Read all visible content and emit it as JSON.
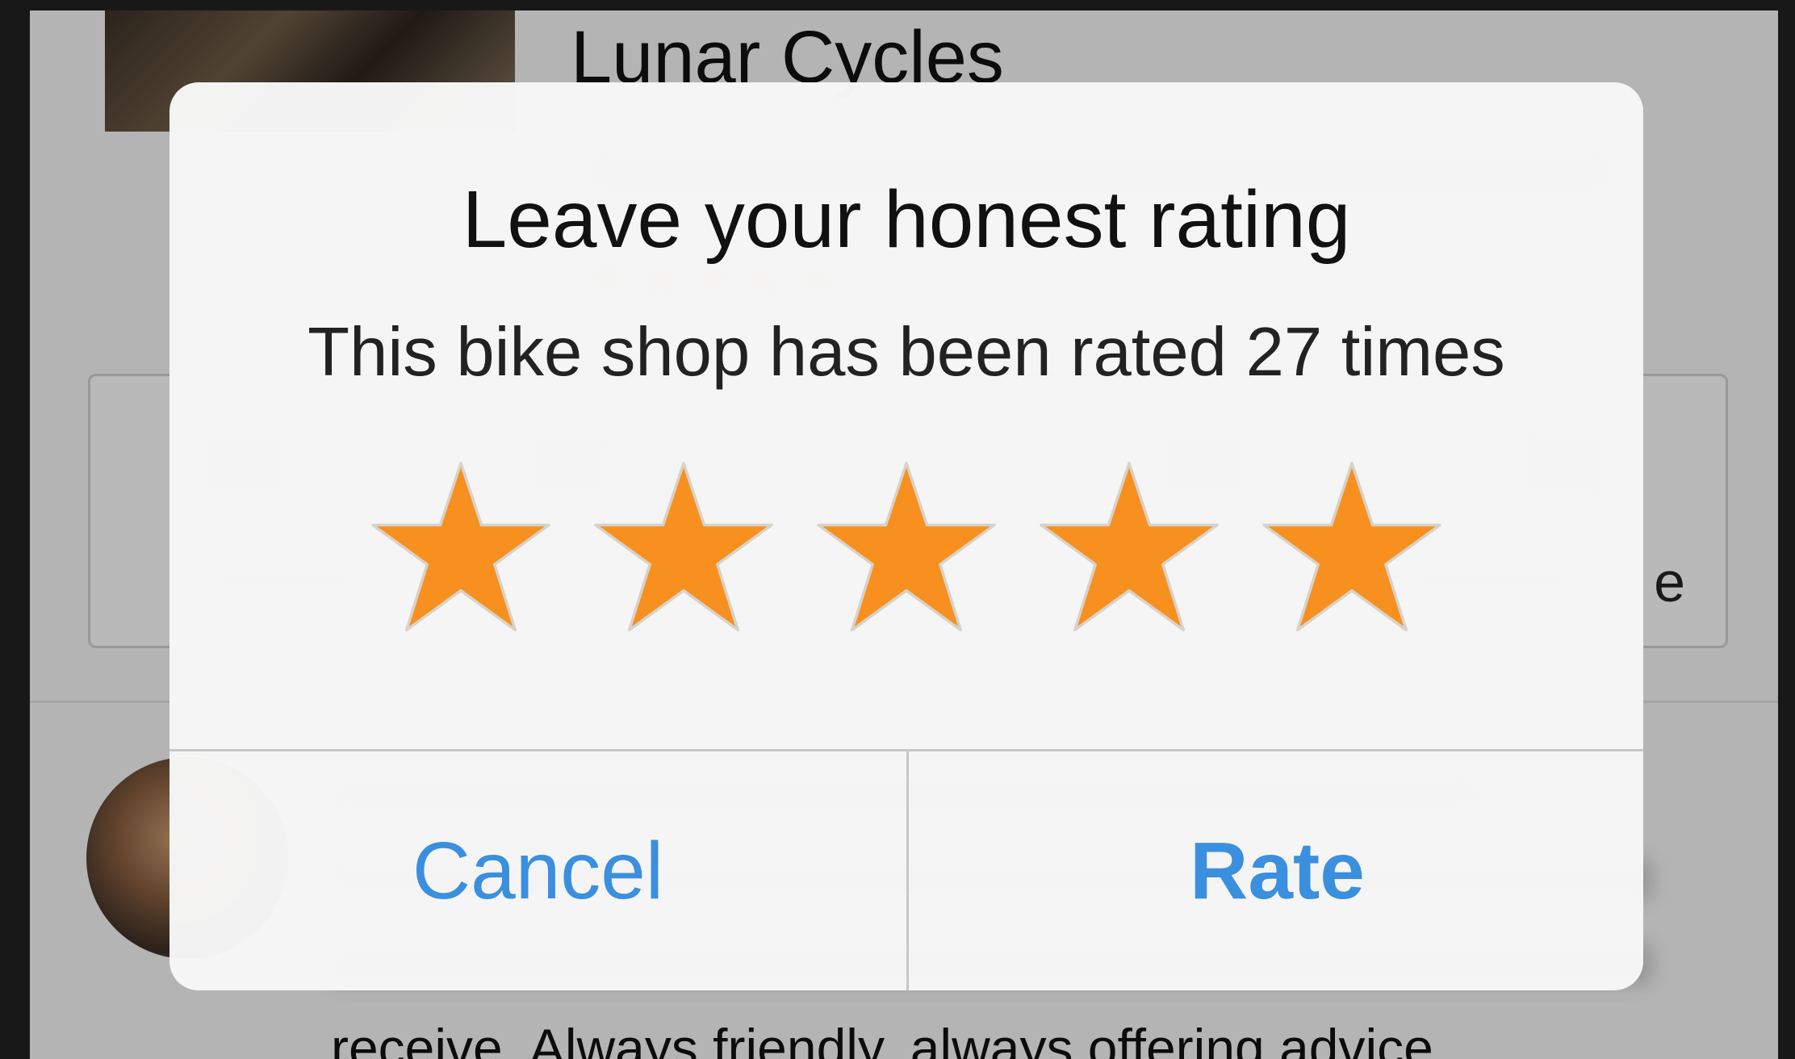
{
  "background": {
    "shop_name": "Lunar Cycles",
    "action_trailing_fragment": "e",
    "review_last_line": "receive. Always friendly, always offering advice"
  },
  "alert": {
    "title": "Leave your honest rating",
    "message": "This bike shop has been rated 27 times",
    "rating": {
      "selected": 5,
      "max": 5
    },
    "buttons": {
      "cancel": "Cancel",
      "rate": "Rate"
    }
  },
  "colors": {
    "star_fill": "#F7901E",
    "button_text": "#3A8FDF"
  },
  "icons": [
    "star-icon",
    "star-icon",
    "star-icon",
    "star-icon",
    "star-icon"
  ]
}
